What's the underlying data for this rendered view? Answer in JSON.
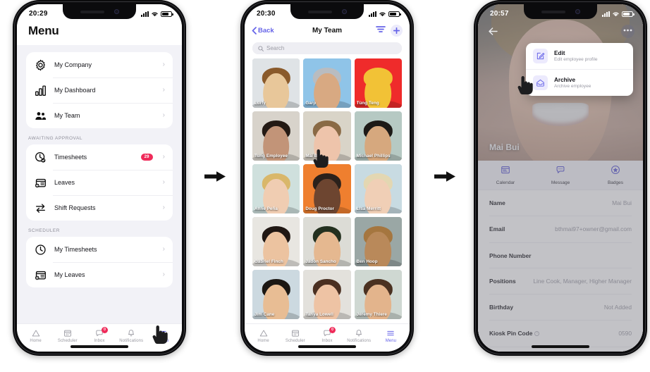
{
  "flow": {
    "arrow_glyph": "→",
    "arrow_1_name": "flow-arrow-1",
    "arrow_2_name": "flow-arrow-2"
  },
  "phone1": {
    "status": {
      "time": "20:29",
      "battery": "47"
    },
    "header": {
      "title": "Menu"
    },
    "groups": [
      {
        "label": "",
        "items": [
          {
            "icon": "gear-icon",
            "label": "My Company",
            "badge": ""
          },
          {
            "icon": "chart-icon",
            "label": "My Dashboard",
            "badge": ""
          },
          {
            "icon": "people-icon",
            "label": "My Team",
            "badge": ""
          }
        ]
      },
      {
        "label": "AWAITING APPROVAL",
        "items": [
          {
            "icon": "clock-check-icon",
            "label": "Timesheets",
            "badge": "29"
          },
          {
            "icon": "leave-icon",
            "label": "Leaves",
            "badge": ""
          },
          {
            "icon": "swap-icon",
            "label": "Shift Requests",
            "badge": ""
          }
        ]
      },
      {
        "label": "SCHEDULER",
        "items": [
          {
            "icon": "clock-icon",
            "label": "My Timesheets",
            "badge": ""
          },
          {
            "icon": "leave-icon",
            "label": "My Leaves",
            "badge": ""
          }
        ]
      }
    ],
    "tabs": [
      {
        "icon": "home-icon",
        "label": "Home",
        "active": false,
        "badge": ""
      },
      {
        "icon": "scheduler-icon",
        "label": "Scheduler",
        "active": false,
        "badge": ""
      },
      {
        "icon": "inbox-icon",
        "label": "Inbox",
        "active": false,
        "badge": "0"
      },
      {
        "icon": "notifications-icon",
        "label": "Notifications",
        "active": false,
        "badge": ""
      },
      {
        "icon": "menu-icon",
        "label": "Menu",
        "active": true,
        "badge": ""
      }
    ]
  },
  "phone2": {
    "status": {
      "time": "20:30",
      "battery": "47"
    },
    "nav": {
      "back": "Back",
      "title": "My Team",
      "filter_icon": "filter-icon",
      "add_icon": "plus-icon"
    },
    "search": {
      "placeholder": "Search",
      "icon": "search-icon"
    },
    "members": [
      {
        "name": "Lurfy",
        "skin": "#e8c79a",
        "hair": "#8a5a2b",
        "bg": "#dfe3e6"
      },
      {
        "name": "Garp",
        "skin": "#d8a982",
        "hair": "#b9bcc0",
        "bg": "#8fc4e8"
      },
      {
        "name": "Tùng Teng",
        "skin": "#f2c236",
        "hair": "#f2c236",
        "bg": "#ef2b2b"
      },
      {
        "name": "Tung Employee",
        "skin": "#c29478",
        "hair": "#241a14",
        "bg": "#d8d3cb"
      },
      {
        "name": "Mai Bui",
        "skin": "#eec4ab",
        "hair": "#8a6a45",
        "bg": "#d9d4c8"
      },
      {
        "name": "Michael Phillips",
        "skin": "#d6a87e",
        "hair": "#1d1a17",
        "bg": "#b6c9c3"
      },
      {
        "name": "Anne Peña",
        "skin": "#f0cdb2",
        "hair": "#d9b76a",
        "bg": "#cfe0dd"
      },
      {
        "name": "Doug Proctor",
        "skin": "#6d4530",
        "hair": "#2b211b",
        "bg": "#ef7f2f"
      },
      {
        "name": "Lisa Merritt",
        "skin": "#f0cfb6",
        "hair": "#e3d7b2",
        "bg": "#c8dbe2"
      },
      {
        "name": "Gabriel Finch",
        "skin": "#ecc3a0",
        "hair": "#201713",
        "bg": "#e8e6e1"
      },
      {
        "name": "Jadon Sancho",
        "skin": "#e5b890",
        "hair": "#23301f",
        "bg": "#dcdcd6"
      },
      {
        "name": "Ben Hoop",
        "skin": "#b9895a",
        "hair": "#a5763f",
        "bg": "#9aa7a5"
      },
      {
        "name": "Jim Cane",
        "skin": "#e8bd94",
        "hair": "#1b1713",
        "bg": "#ccd9e0"
      },
      {
        "name": "Tanya Lowell",
        "skin": "#eec3a4",
        "hair": "#4a2f21",
        "bg": "#e3e1dc"
      },
      {
        "name": "Jeremy Thiere",
        "skin": "#e3b48c",
        "hair": "#4a3121",
        "bg": "#cfd8d2"
      }
    ],
    "tabs": [
      {
        "icon": "home-icon",
        "label": "Home",
        "active": false,
        "badge": ""
      },
      {
        "icon": "scheduler-icon",
        "label": "Scheduler",
        "active": false,
        "badge": ""
      },
      {
        "icon": "inbox-icon",
        "label": "Inbox",
        "active": false,
        "badge": "0"
      },
      {
        "icon": "notifications-icon",
        "label": "Notifications",
        "active": false,
        "badge": ""
      },
      {
        "icon": "menu-icon",
        "label": "Menu",
        "active": true,
        "badge": ""
      }
    ]
  },
  "phone3": {
    "status": {
      "time": "20:57",
      "battery": "41"
    },
    "hero": {
      "name": "Mai Bui",
      "back_icon": "back-arrow-icon",
      "more_icon": "more-dots-icon"
    },
    "popup": [
      {
        "icon": "edit-icon",
        "title": "Edit",
        "subtitle": "Edit employee profile"
      },
      {
        "icon": "archive-icon",
        "title": "Archive",
        "subtitle": "Archive employee"
      }
    ],
    "quick_tabs": [
      {
        "icon": "calendar-icon",
        "label": "Calendar"
      },
      {
        "icon": "message-icon",
        "label": "Message"
      },
      {
        "icon": "badge-star-icon",
        "label": "Badges"
      }
    ],
    "fields": [
      {
        "key": "Name",
        "value": "Mai Bui",
        "info": false
      },
      {
        "key": "Email",
        "value": "bthmai97+owner@gmail.com",
        "info": false
      },
      {
        "key": "Phone Number",
        "value": "",
        "info": false
      },
      {
        "key": "Positions",
        "value": "Line Cook, Manager, Higher Manager",
        "info": false
      },
      {
        "key": "Birthday",
        "value": "Not Added",
        "info": false
      },
      {
        "key": "Kiosk Pin Code",
        "value": "0590",
        "info": true
      }
    ]
  },
  "colors": {
    "accent": "#6563e8",
    "danger": "#ef2b5a",
    "bg_grey": "#f2f2f7"
  }
}
